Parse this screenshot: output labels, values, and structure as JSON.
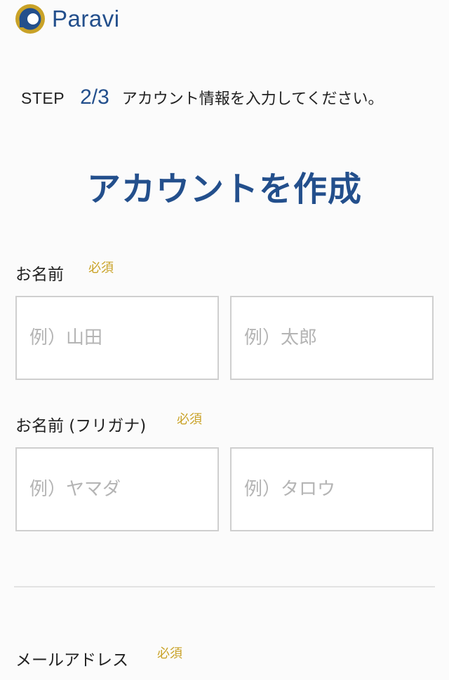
{
  "header": {
    "brand": "Paravi"
  },
  "step": {
    "label": "STEP",
    "number": "2/3",
    "description": "アカウント情報を入力してください。"
  },
  "page": {
    "title": "アカウントを作成"
  },
  "form": {
    "name": {
      "label": "お名前",
      "required": "必須",
      "last_placeholder": "例）山田",
      "first_placeholder": "例）太郎"
    },
    "kana": {
      "label": "お名前 (フリガナ)",
      "required": "必須",
      "last_placeholder": "例）ヤマダ",
      "first_placeholder": "例）タロウ"
    },
    "email": {
      "label": "メールアドレス",
      "required": "必須"
    }
  },
  "colors": {
    "brand": "#234f8c",
    "required": "#c9a227",
    "border": "#cfcfcf"
  },
  "icons": {
    "logo": "paravi-logo-icon"
  }
}
